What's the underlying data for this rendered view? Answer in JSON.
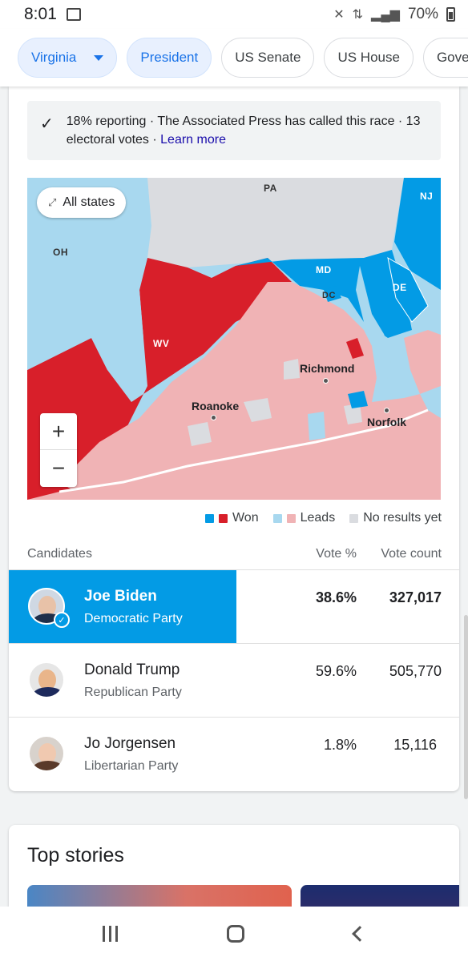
{
  "status_bar": {
    "time": "8:01",
    "battery": "70%"
  },
  "chips": [
    {
      "label": "Virginia",
      "active": true,
      "dropdown": true
    },
    {
      "label": "President",
      "active": true
    },
    {
      "label": "US Senate"
    },
    {
      "label": "US House"
    },
    {
      "label": "Gover"
    }
  ],
  "notice": {
    "text": "18% reporting · The Associated Press has called this race · 13 electoral votes · ",
    "link": "Learn more"
  },
  "map": {
    "all_states_label": "All states",
    "state_labels": {
      "pa": "PA",
      "nj": "NJ",
      "oh": "OH",
      "md": "MD",
      "de": "DE",
      "dc": "DC",
      "wv": "WV"
    },
    "cities": {
      "richmond": "Richmond",
      "roanoke": "Roanoke",
      "norfolk": "Norfolk"
    },
    "zoom_in": "+",
    "zoom_out": "−"
  },
  "legend": {
    "won": "Won",
    "leads": "Leads",
    "no_results": "No results yet"
  },
  "colors": {
    "dem_won": "#039be5",
    "rep_won": "#d81f2a",
    "dem_leads": "#a8d8ef",
    "rep_leads": "#f0b3b5",
    "no_results": "#dadce0"
  },
  "table": {
    "headers": {
      "candidates": "Candidates",
      "vote_pct": "Vote %",
      "vote_count": "Vote count"
    },
    "rows": [
      {
        "name": "Joe Biden",
        "party": "Democratic Party",
        "pct": "38.6%",
        "count": "327,017",
        "winner": true
      },
      {
        "name": "Donald Trump",
        "party": "Republican Party",
        "pct": "59.6%",
        "count": "505,770"
      },
      {
        "name": "Jo Jorgensen",
        "party": "Libertarian Party",
        "pct": "1.8%",
        "count": "15,116"
      }
    ]
  },
  "top_stories": {
    "title": "Top stories"
  }
}
